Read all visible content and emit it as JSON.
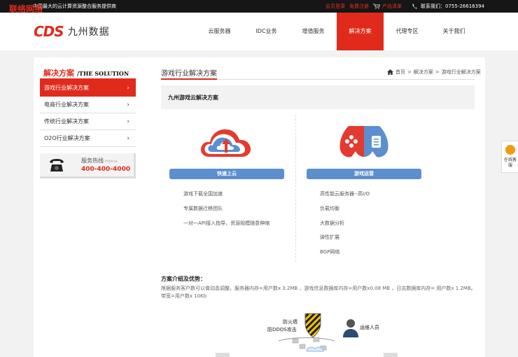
{
  "topbar": {
    "overlay_title": "联络网络",
    "slogan": "中国最大的云计算资源整合服务提供商",
    "member_login": "会员登录",
    "free_register": "免费注册",
    "product_list": "产品清单",
    "contact": "联系我们：0755-26616394"
  },
  "header": {
    "logo_mark": "CDS",
    "logo_name": "九州数据",
    "nav": [
      {
        "label": "云服务器"
      },
      {
        "label": "IDC业务"
      },
      {
        "label": "增值服务"
      },
      {
        "label": "解决方案"
      },
      {
        "label": "代理专区"
      },
      {
        "label": "关于我们"
      }
    ]
  },
  "sidebar": {
    "title_cn": "解决方案",
    "title_en": "/THE SOLUTION",
    "items": [
      {
        "label": "游戏行业解决方案"
      },
      {
        "label": "电商行业解决方案"
      },
      {
        "label": "传统行业解决方案"
      },
      {
        "label": "O2O行业解决方案"
      }
    ],
    "arrow": "›",
    "hotline_label": "服务热线",
    "hotline_small": "Hotline",
    "hotline_number": "400-400-4000"
  },
  "main": {
    "title": "游戏行业解决方案",
    "breadcrumb": {
      "home": "首页",
      "sep": ">",
      "level1": "解决方案",
      "level2": "游戏行业解决方案"
    },
    "solution_title": "九州游戏云解决方案",
    "left_col": {
      "button": "快速上云",
      "features": [
        "游戏下载全国加速",
        "专属数据迁移团队",
        "一对一API接入指导，资源规模随意伸缩"
      ]
    },
    "right_col": {
      "button": "游戏运营",
      "features": [
        "高性能云服务器--高I/O",
        "负载均衡",
        "大数据分析",
        "弹性扩展",
        "BGP网络"
      ]
    },
    "intro_title": "方案介绍及优势：",
    "intro_text": "根据服务客户数可以做动态调整，服务器内存=用户数x 3.2MB ，游戏信息数据库内存=用户数x0.08 MB ，日志数据库内存= 用户数x 1.2MB。带宽=用户数x 10Kb",
    "diagram": {
      "firewall": "防火墙",
      "ddos": "防DDOS攻击",
      "ops": "运维人员"
    }
  },
  "float_chat": {
    "label": "在线客服"
  },
  "colors": {
    "accent": "#e02b1c",
    "button": "#5c8fce",
    "topbar": "#161616"
  }
}
